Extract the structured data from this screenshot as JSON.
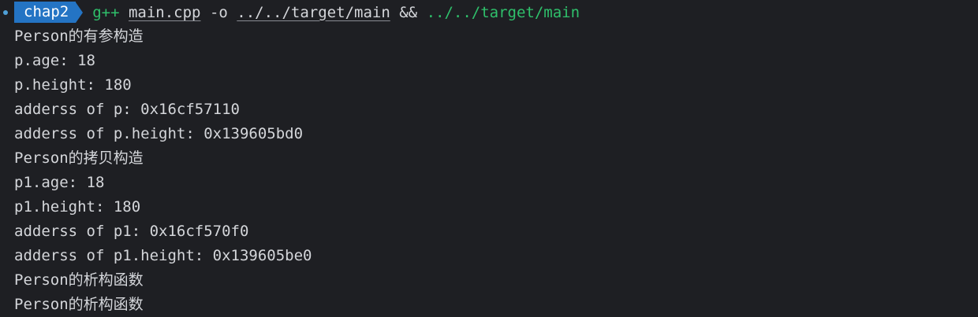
{
  "prompt": {
    "directory": "chap2",
    "command": "g++",
    "source_file": "main.cpp",
    "flag": "-o",
    "output_path": "../../target/main",
    "operator": "&&",
    "run_path": "../../target/main"
  },
  "output_lines": [
    "Person的有参构造",
    "p.age: 18",
    "p.height: 180",
    "adderss of p: 0x16cf57110",
    "adderss of p.height: 0x139605bd0",
    "Person的拷贝构造",
    "p1.age: 18",
    "p1.height: 180",
    "adderss of p1: 0x16cf570f0",
    "adderss of p1.height: 0x139605be0",
    "Person的析构函数",
    "Person的析构函数"
  ],
  "colors": {
    "background": "#1e1f23",
    "badge": "#2474c4",
    "command_green": "#2fc06b",
    "text": "#d4d6da"
  }
}
